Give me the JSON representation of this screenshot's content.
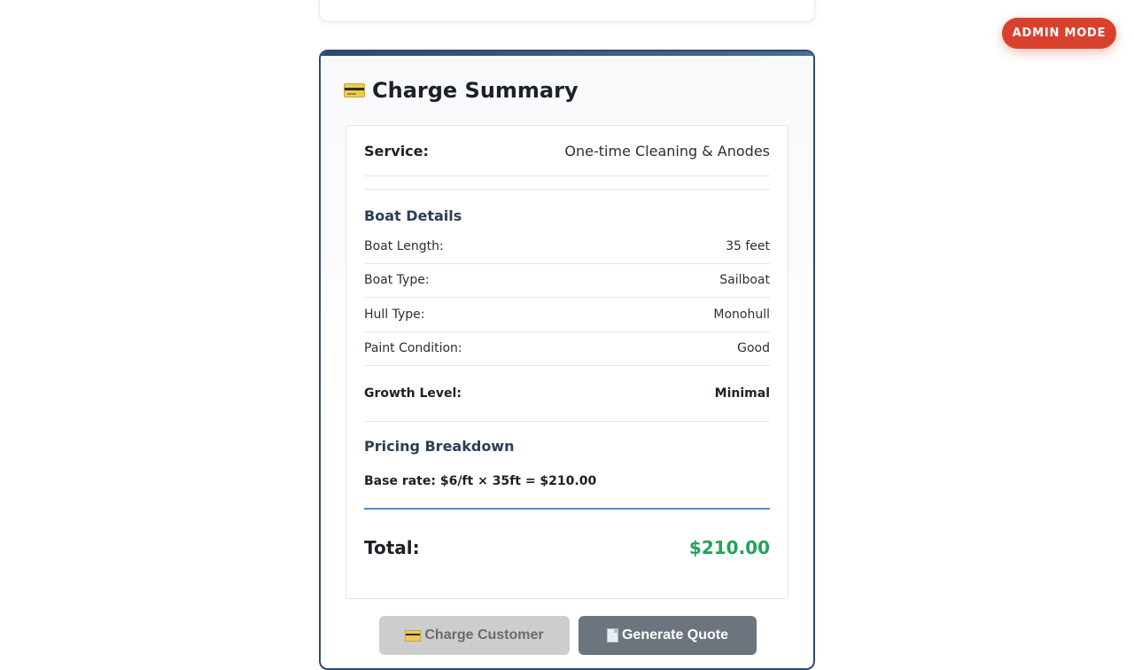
{
  "admin": {
    "label": "ADMIN MODE"
  },
  "summary": {
    "title": "Charge Summary",
    "service": {
      "label": "Service:",
      "value": "One-time Cleaning & Anodes"
    },
    "boat_details": {
      "title": "Boat Details",
      "rows": [
        {
          "label": "Boat Length:",
          "value": "35 feet"
        },
        {
          "label": "Boat Type:",
          "value": "Sailboat"
        },
        {
          "label": "Hull Type:",
          "value": "Monohull"
        },
        {
          "label": "Paint Condition:",
          "value": "Good"
        }
      ],
      "growth": {
        "label": "Growth Level:",
        "value": "Minimal"
      }
    },
    "pricing": {
      "title": "Pricing Breakdown",
      "base_rate": "Base rate: $6/ft × 35ft = $210.00"
    },
    "total": {
      "label": "Total:",
      "value": "$210.00"
    }
  },
  "actions": {
    "charge_label": "Charge Customer",
    "quote_label": "Generate Quote"
  },
  "colors": {
    "admin_button": "#d9412f",
    "card_border": "#2d4a6e",
    "total_value": "#22a35a",
    "divider_accent": "#4a90d9",
    "charge_button": "#cdcdcd",
    "quote_button": "#6c757d"
  },
  "icons": {
    "title": "credit-card-icon",
    "charge": "credit-card-icon",
    "quote": "document-icon"
  }
}
